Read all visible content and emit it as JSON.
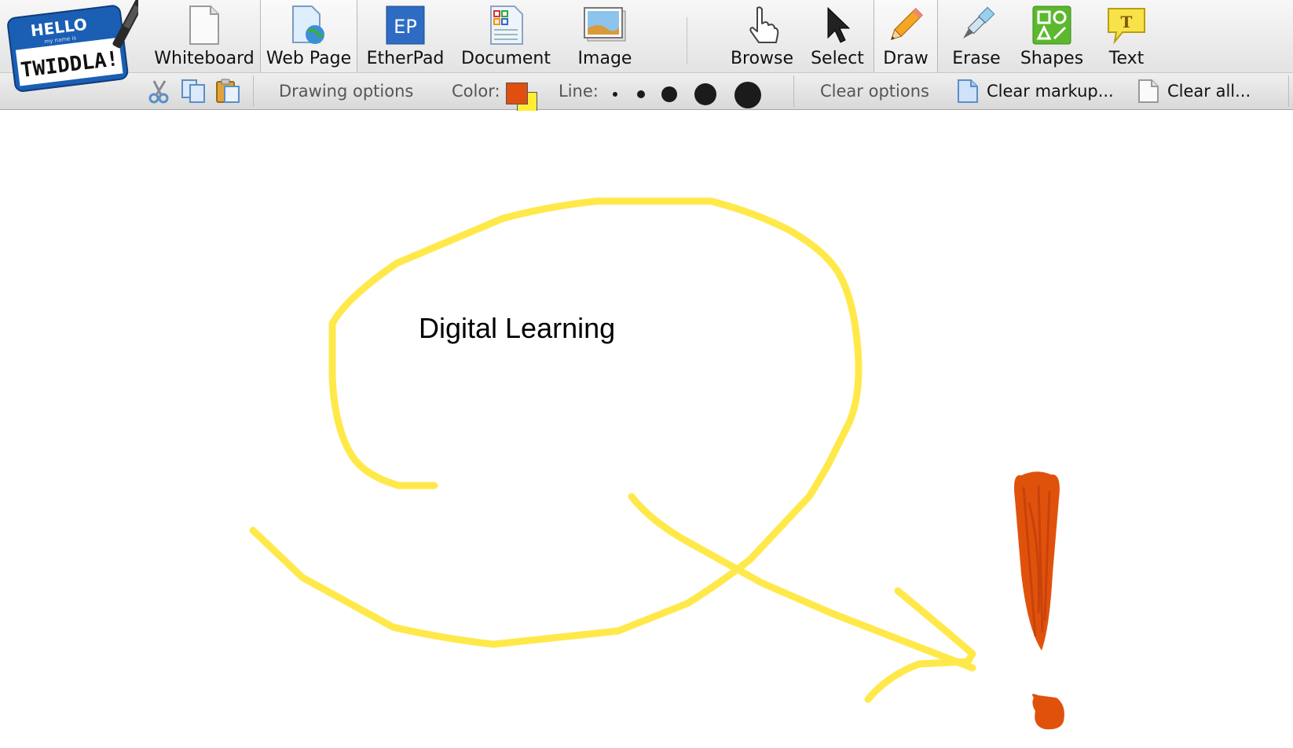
{
  "logo": {
    "line1": "HELLO",
    "line2": "my name is",
    "line3": "TWIDDLA!"
  },
  "tools": {
    "whiteboard": "Whiteboard",
    "webpage": "Web Page",
    "etherpad": "EtherPad",
    "etherpad_badge": "EP",
    "document": "Document",
    "image": "Image",
    "browse": "Browse",
    "select": "Select",
    "draw": "Draw",
    "erase": "Erase",
    "shapes": "Shapes",
    "text": "Text",
    "text_badge": "T"
  },
  "options": {
    "drawing_options": "Drawing options",
    "color_label": "Color:",
    "line_label": "Line:",
    "clear_options": "Clear options",
    "clear_markup": "Clear markup...",
    "clear_all": "Clear all..."
  },
  "colors": {
    "primary": "#e04e10",
    "secondary": "#ffee33",
    "ink_yellow": "#ffe94a",
    "ink_orange": "#e0520c"
  },
  "canvas": {
    "text": "Digital Learning"
  }
}
